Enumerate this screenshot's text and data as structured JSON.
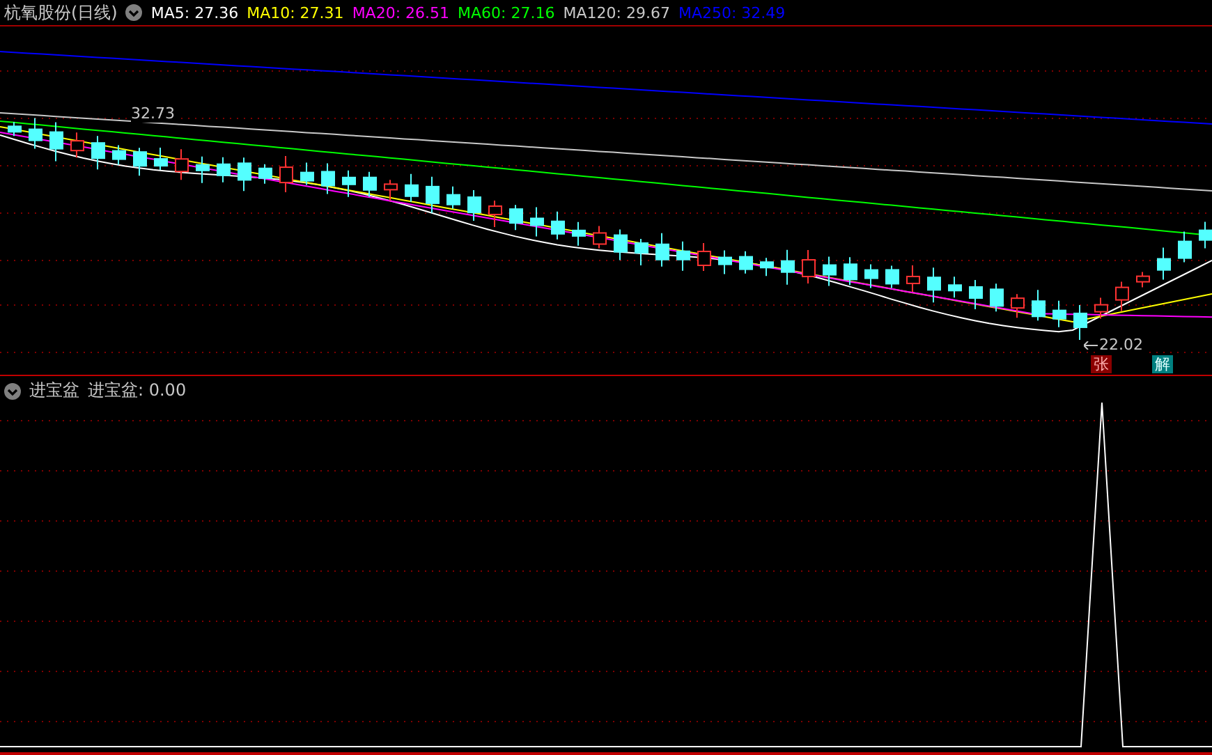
{
  "main_panel": {
    "title": "杭氧股份(日线)",
    "moving_averages": [
      {
        "label": "MA5: 27.36",
        "color": "#ffffff"
      },
      {
        "label": "MA10: 27.31",
        "color": "#ffff00"
      },
      {
        "label": "MA20: 26.51",
        "color": "#ff00ff"
      },
      {
        "label": "MA60: 27.16",
        "color": "#00ff00"
      },
      {
        "label": "MA120: 29.67",
        "color": "#c8c8c8"
      },
      {
        "label": "MA250: 32.49",
        "color": "#0000ff"
      }
    ],
    "high_label": "32.73",
    "low_label": "22.02",
    "markers": [
      {
        "text": "张",
        "kind": "rise"
      },
      {
        "text": "解",
        "kind": "unlock"
      }
    ]
  },
  "indicator_panel": {
    "title": "进宝盆",
    "reading": "进宝盆: 0.00"
  }
}
